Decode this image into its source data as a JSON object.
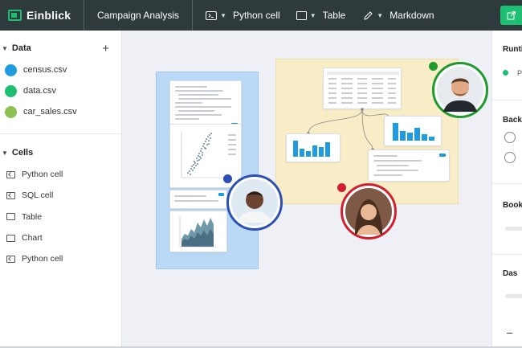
{
  "app": {
    "name": "Einblick",
    "document_title": "Campaign Analysis",
    "toolbar": [
      {
        "label": "Python cell",
        "icon": "code-cell-icon"
      },
      {
        "label": "Table",
        "icon": "table-icon"
      },
      {
        "label": "Markdown",
        "icon": "pencil-icon"
      }
    ],
    "colors": {
      "brand": "#1fbf73",
      "topbar": "#2f3a3d",
      "blue_group": "#b9d9f6",
      "yellow_group": "#f8edc6",
      "bar": "#1f9be0"
    }
  },
  "sidebar": {
    "data_title": "Data",
    "add_label": "+",
    "datasets": [
      {
        "name": "census.csv",
        "color": "#1f9be0"
      },
      {
        "name": "data.csv",
        "color": "#1fbf73"
      },
      {
        "name": "car_sales.csv",
        "color": "#8cc152"
      }
    ],
    "cells_title": "Cells",
    "cells": [
      {
        "name": "Python cell",
        "icon": "code-cell-icon"
      },
      {
        "name": "SQL cell",
        "icon": "code-cell-icon"
      },
      {
        "name": "Table",
        "icon": "table-icon"
      },
      {
        "name": "Chart",
        "icon": "chart-icon"
      },
      {
        "name": "Python cell",
        "icon": "code-cell-icon"
      }
    ]
  },
  "right_panel": {
    "runtime_label": "Runti",
    "runtime_status": "P",
    "backend_label": "Backe",
    "bookmarks_label": "Book",
    "dashboard_label": "Das",
    "collapse_label": "–"
  },
  "collaborators": [
    {
      "name": "collaborator-1",
      "ring": "#2b4fb5"
    },
    {
      "name": "collaborator-2",
      "ring": "#d21f2f"
    },
    {
      "name": "collaborator-3",
      "ring": "#1f9a2e"
    }
  ]
}
